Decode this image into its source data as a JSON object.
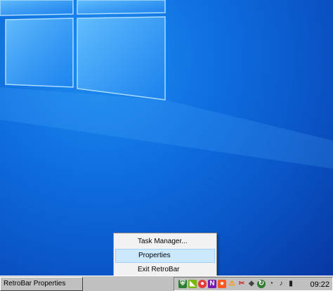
{
  "context_menu": {
    "items": [
      {
        "label": "Task Manager..."
      },
      {
        "label": "Properties"
      },
      {
        "label": "Exit RetroBar"
      }
    ]
  },
  "taskbar": {
    "window_button": "RetroBar Properties",
    "clock": "09:22",
    "tray_icons": [
      "shield-icon",
      "nvidia-icon",
      "color-icon",
      "onenote-icon",
      "record-icon",
      "warning-icon",
      "snip-icon",
      "network-icon",
      "sync-icon",
      "wifi-icon",
      "volume-icon",
      "battery-icon"
    ]
  },
  "colors": {
    "desktop_top": "#1f8ef0",
    "desktop_bottom": "#07349e",
    "taskbar": "#c0c0c0",
    "menu_highlight": "#cce8ff"
  }
}
